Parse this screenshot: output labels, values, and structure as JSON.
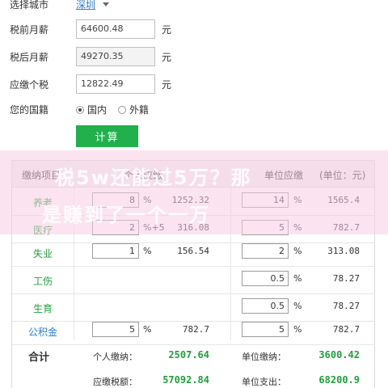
{
  "form": {
    "city_label": "选择城市",
    "city_value": "深圳",
    "pretax_label": "税前月薪",
    "pretax_value": "64600.48",
    "aftertax_label": "税后月薪",
    "aftertax_value": "49270.35",
    "tax_label": "应缴个税",
    "tax_value": "12822.49",
    "unit": "元",
    "nationality_label": "您的国籍",
    "nationality_options": [
      "国内",
      "外籍"
    ],
    "nationality_selected": "国内",
    "calc_button": "计算"
  },
  "table": {
    "headers": {
      "item": "缴纳项目",
      "personal": "个人应缴",
      "employer": "单位应缴",
      "unit_note": "(单位：元)"
    },
    "rows": [
      {
        "name": "养老",
        "p_rate": "8",
        "p_pct": "%",
        "p_amt": "1252.32",
        "e_rate": "14",
        "e_pct": "%",
        "e_amt": "1565.4"
      },
      {
        "name": "医疗",
        "p_rate": "2",
        "p_pct": "%+5",
        "p_amt": "316.08",
        "e_rate": "5",
        "e_pct": "%",
        "e_amt": "782.7"
      },
      {
        "name": "失业",
        "p_rate": "1",
        "p_pct": "%",
        "p_amt": "156.54",
        "e_rate": "2",
        "e_pct": "%",
        "e_amt": "313.08"
      },
      {
        "name": "工伤",
        "p_rate": "",
        "p_pct": "",
        "p_amt": "",
        "e_rate": "0.5",
        "e_pct": "%",
        "e_amt": "78.27"
      },
      {
        "name": "生育",
        "p_rate": "",
        "p_pct": "",
        "p_amt": "",
        "e_rate": "0.5",
        "e_pct": "%",
        "e_amt": "78.27"
      },
      {
        "name": "公积金",
        "p_rate": "5",
        "p_pct": "%",
        "p_amt": "782.7",
        "e_rate": "5",
        "e_pct": "%",
        "e_amt": "782.7"
      }
    ],
    "total": {
      "label": "合计",
      "personal_label": "个人缴纳：",
      "personal_value": "2507.64",
      "employer_label": "单位缴纳：",
      "employer_value": "3600.42",
      "taxable_label": "应缴税额：",
      "taxable_value": "57092.84",
      "expense_label": "单位支出：",
      "expense_value": "68200.9"
    }
  },
  "banner": {
    "line1": "税5w还能过5万？那",
    "line2": "是赚到了一个一万"
  },
  "colors": {
    "accent_green": "#21b04b",
    "link_blue": "#2b7ccf",
    "banner_pink": "#f7cee4"
  }
}
